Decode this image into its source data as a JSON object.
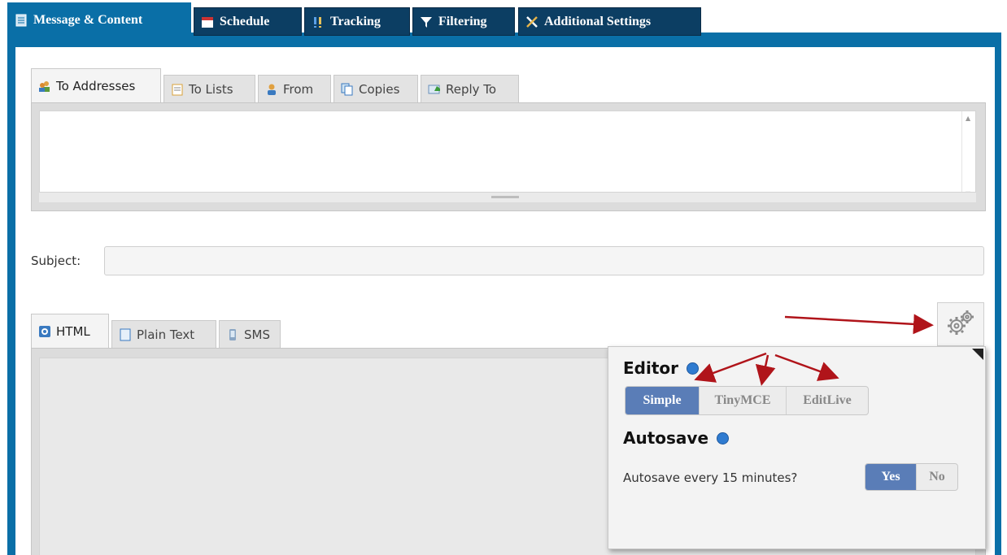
{
  "main_tabs": [
    {
      "label": "Message & Content",
      "icon": "document-icon",
      "active": true
    },
    {
      "label": "Schedule",
      "icon": "calendar-icon"
    },
    {
      "label": "Tracking",
      "icon": "tracking-icon"
    },
    {
      "label": "Filtering",
      "icon": "filter-icon"
    },
    {
      "label": "Additional Settings",
      "icon": "tools-icon"
    }
  ],
  "recipient_tabs": [
    {
      "label": "To Addresses",
      "icon": "users-icon",
      "active": true
    },
    {
      "label": "To Lists",
      "icon": "list-icon"
    },
    {
      "label": "From",
      "icon": "user-icon"
    },
    {
      "label": "Copies",
      "icon": "copies-icon"
    },
    {
      "label": "Reply To",
      "icon": "reply-icon"
    }
  ],
  "subject": {
    "label": "Subject:",
    "value": ""
  },
  "content_tabs": [
    {
      "label": "HTML",
      "icon": "html-icon",
      "active": true
    },
    {
      "label": "Plain Text",
      "icon": "document-icon"
    },
    {
      "label": "SMS",
      "icon": "phone-icon"
    }
  ],
  "settings_popup": {
    "editor_title": "Editor",
    "editor_options": [
      "Simple",
      "TinyMCE",
      "EditLive"
    ],
    "editor_selected": "Simple",
    "autosave_title": "Autosave",
    "autosave_question": "Autosave every 15 minutes?",
    "autosave_options": [
      "Yes",
      "No"
    ],
    "autosave_selected": "Yes"
  },
  "colors": {
    "frame": "#0a6fa7",
    "tab_dark": "#0c3e63",
    "selected": "#5a7db7",
    "annotation_arrow": "#b0141a"
  }
}
